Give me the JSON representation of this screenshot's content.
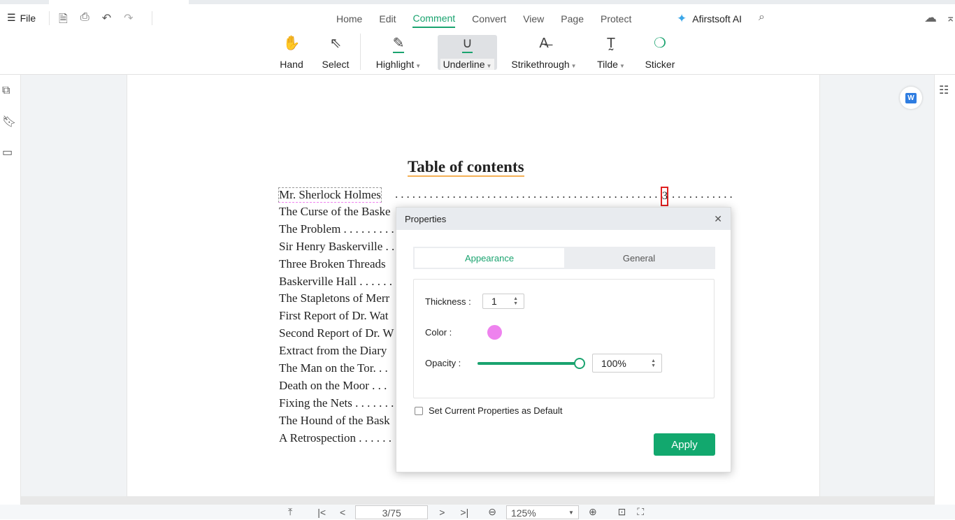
{
  "topbar": {
    "file": "File",
    "menu": [
      "Home",
      "Edit",
      "Comment",
      "Convert",
      "View",
      "Page",
      "Protect"
    ],
    "active_menu": "Comment",
    "ai_label": "Afirstsoft AI"
  },
  "toolbar": {
    "hand": "Hand",
    "select": "Select",
    "highlight": "Highlight",
    "underline": "Underline",
    "strikethrough": "Strikethrough",
    "tilde": "Tilde",
    "sticker": "Sticker",
    "active_tool": "Underline"
  },
  "document": {
    "title": "Table of contents",
    "entries": [
      "Mr. Sherlock Holmes",
      "The Curse of the Baske",
      "The Problem . . . . . . . . .",
      "Sir Henry Baskerville . .",
      "Three Broken Threads",
      "Baskerville Hall . . . . . .",
      "The Stapletons of Merr",
      "First Report of Dr. Wat",
      "Second Report of Dr. W",
      "Extract from the Diary",
      "The Man on the Tor. . .",
      "Death on the Moor . . .",
      "Fixing the Nets . . . . . . .",
      "The Hound of the Bask",
      "A Retrospection . . . . . ."
    ],
    "first_page_number": "3"
  },
  "dialog": {
    "title": "Properties",
    "tabs": [
      "Appearance",
      "General"
    ],
    "active_tab": "Appearance",
    "thickness_label": "Thickness :",
    "thickness_value": "1",
    "color_label": "Color :",
    "color_value": "#ee82ee",
    "opacity_label": "Opacity :",
    "opacity_value": "100%",
    "opacity_fraction": 1.0,
    "default_checkbox": "Set Current Properties as Default",
    "default_checked": false,
    "apply": "Apply"
  },
  "bottombar": {
    "page": "3/75",
    "zoom": "125%"
  },
  "colors": {
    "accent": "#1aa36f",
    "apply_bg": "#12a86e"
  }
}
